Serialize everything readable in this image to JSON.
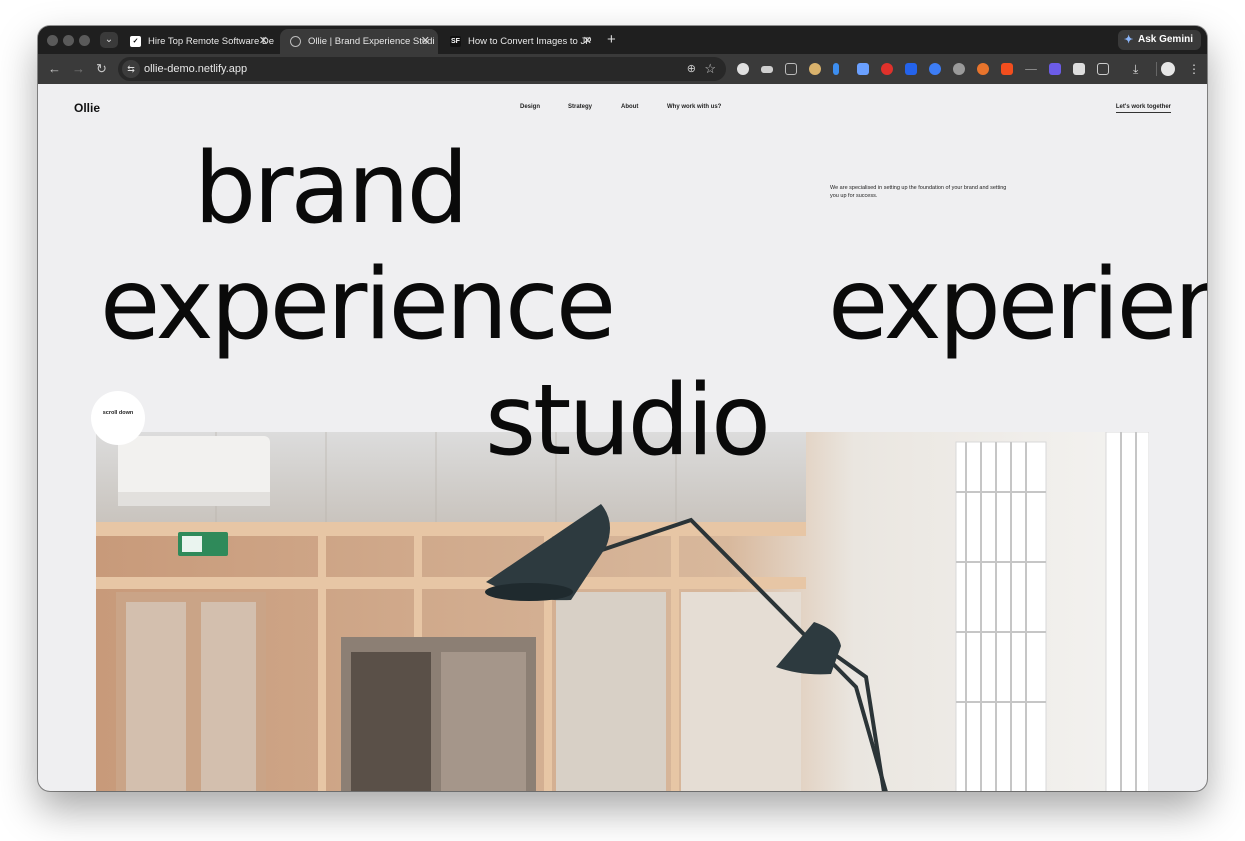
{
  "browser": {
    "tabs": [
      {
        "title": "Hire Top Remote Software De",
        "favicon": "check-badge-icon",
        "active": false
      },
      {
        "title": "Ollie | Brand Experience Studi",
        "favicon": "globe-icon",
        "active": true
      },
      {
        "title": "How to Convert Images to JP",
        "favicon": "sf-icon",
        "active": false
      }
    ],
    "tab_close_glyph": "✕",
    "new_tab_glyph": "+",
    "ask_gemini": "Ask Gemini",
    "url": "ollie-demo.netlify.app"
  },
  "site": {
    "logo": "Ollie",
    "nav": [
      "Design",
      "Strategy",
      "About",
      "Why work with us?"
    ],
    "cta": "Let's work together",
    "tagline": "We are specialised in setting up the foundation of your brand and setting you up for success.",
    "hero": {
      "line1": "brand",
      "line2": "experience",
      "line2_repeat": "experien",
      "line3": "studio"
    },
    "scroll_badge": "scroll down"
  },
  "colors": {
    "page_bg": "#efeff1",
    "text": "#0a0a0a",
    "browser_chrome": "#3a3a3a"
  }
}
